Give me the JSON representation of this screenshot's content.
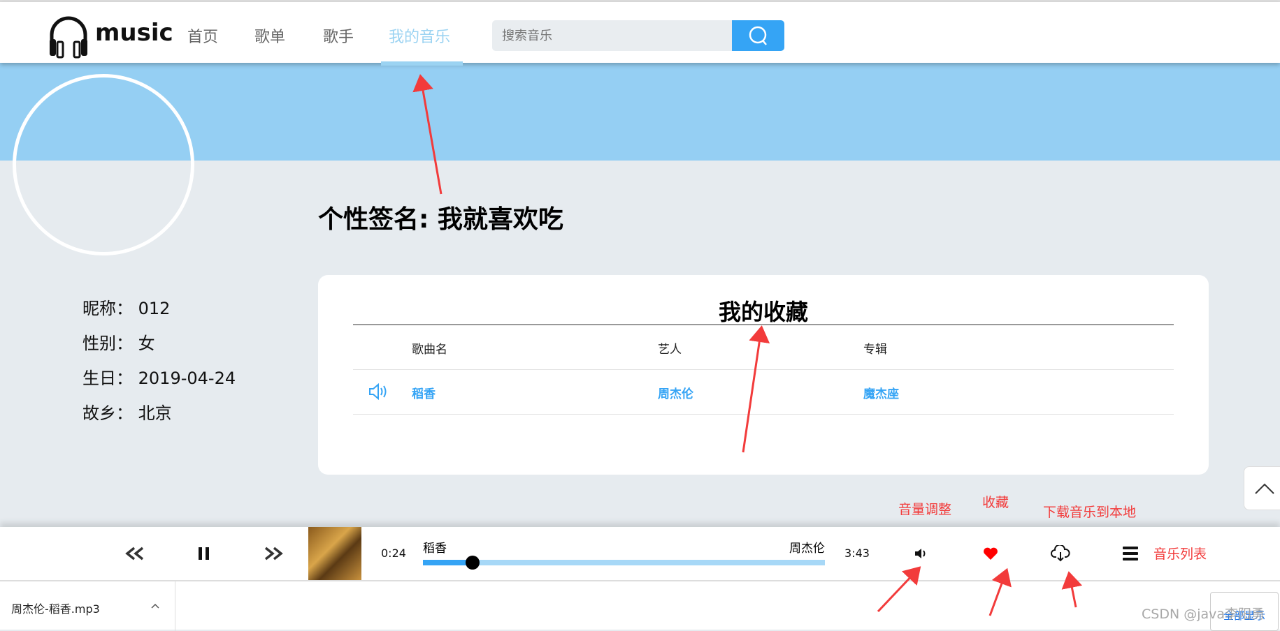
{
  "header": {
    "logo_text": "music",
    "nav": [
      "首页",
      "歌单",
      "歌手",
      "我的音乐"
    ],
    "active_nav": "我的音乐",
    "search_placeholder": "搜索音乐"
  },
  "profile": {
    "signature": "个性签名: 我就喜欢吃",
    "info": [
      {
        "label": "昵称：",
        "value": "012"
      },
      {
        "label": "性别：",
        "value": "女"
      },
      {
        "label": "生日：",
        "value": "2019-04-24"
      },
      {
        "label": "故乡：",
        "value": "北京"
      }
    ]
  },
  "favorites": {
    "title": "我的收藏",
    "columns": [
      "歌曲名",
      "艺人",
      "专辑"
    ],
    "rows": [
      {
        "song": "稻香",
        "artist": "周杰伦",
        "album": "魔杰座"
      }
    ]
  },
  "annotations": {
    "volume": "音量调整",
    "favorite": "收藏",
    "download": "下载音乐到本地",
    "playlist": "音乐列表"
  },
  "player": {
    "current_time": "0:24",
    "duration": "3:43",
    "song": "稻香",
    "artist": "周杰伦",
    "progress": 0.124
  },
  "download_bar": {
    "file": "周杰伦-稻香.mp3",
    "show_all": "全部显示"
  },
  "watermark": "CSDN @java李阳勇",
  "colors": {
    "accent": "#35a4f5",
    "banner": "#95cff3",
    "annotation": "#f23b3b",
    "heart": "#ff0000"
  }
}
